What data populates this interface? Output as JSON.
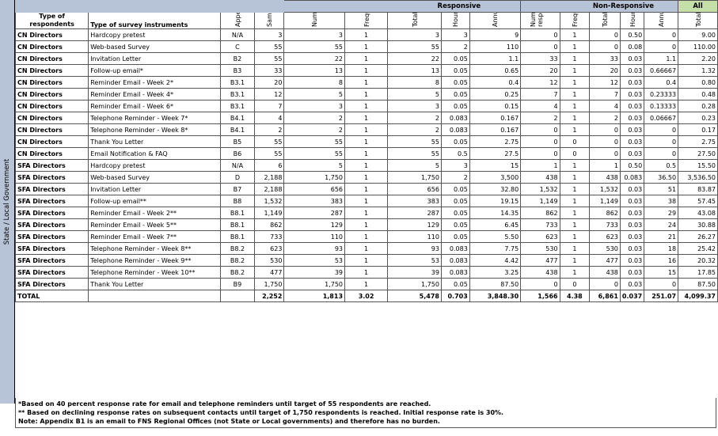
{
  "side_label": "State / Local Government",
  "groups": {
    "responsive": "Responsive",
    "non_responsive": "Non-Responsive",
    "all": "All"
  },
  "headers": [
    "Type of respondents",
    "Type of survey instruments",
    "Appendix",
    "Sample Size",
    "Number of respondents",
    "Frequency of response",
    "Total Annual responses",
    "Hours per response",
    "Annual burden (hours)",
    "Number of Non-respondents",
    "Frequency of response",
    "Total Annual responses",
    "Hours per response",
    "Annual burden (hours)",
    "Total Annual hour burden"
  ],
  "rows": [
    [
      "CN Directors",
      "Hardcopy pretest",
      "N/A",
      "3",
      "3",
      "1",
      "3",
      "3",
      "9",
      "0",
      "1",
      "0",
      "0.50",
      "0",
      "9.00"
    ],
    [
      "CN Directors",
      "Web-based Survey",
      "C",
      "55",
      "55",
      "1",
      "55",
      "2",
      "110",
      "0",
      "1",
      "0",
      "0.08",
      "0",
      "110.00"
    ],
    [
      "CN Directors",
      "Invitation Letter",
      "B2",
      "55",
      "22",
      "1",
      "22",
      "0.05",
      "1.1",
      "33",
      "1",
      "33",
      "0.03",
      "1.1",
      "2.20"
    ],
    [
      "CN Directors",
      "Follow-up email*",
      "B3",
      "33",
      "13",
      "1",
      "13",
      "0.05",
      "0.65",
      "20",
      "1",
      "20",
      "0.03",
      "0.66667",
      "1.32"
    ],
    [
      "CN Directors",
      "Reminder Email - Week 2*",
      "B3.1",
      "20",
      "8",
      "1",
      "8",
      "0.05",
      "0.4",
      "12",
      "1",
      "12",
      "0.03",
      "0.4",
      "0.80"
    ],
    [
      "CN Directors",
      "Reminder Email - Week 4*",
      "B3.1",
      "12",
      "5",
      "1",
      "5",
      "0.05",
      "0.25",
      "7",
      "1",
      "7",
      "0.03",
      "0.23333",
      "0.48"
    ],
    [
      "CN Directors",
      "Reminder Email - Week 6*",
      "B3.1",
      "7",
      "3",
      "1",
      "3",
      "0.05",
      "0.15",
      "4",
      "1",
      "4",
      "0.03",
      "0.13333",
      "0.28"
    ],
    [
      "CN Directors",
      "Telephone Reminder - Week 7*",
      "B4.1",
      "4",
      "2",
      "1",
      "2",
      "0.083",
      "0.167",
      "2",
      "1",
      "2",
      "0.03",
      "0.06667",
      "0.23"
    ],
    [
      "CN Directors",
      "Telephone Reminder - Week 8*",
      "B4.1",
      "2",
      "2",
      "1",
      "2",
      "0.083",
      "0.167",
      "0",
      "1",
      "0",
      "0.03",
      "0",
      "0.17"
    ],
    [
      "CN Directors",
      "Thank You Letter",
      "B5",
      "55",
      "55",
      "1",
      "55",
      "0.05",
      "2.75",
      "0",
      "0",
      "0",
      "0.03",
      "0",
      "2.75"
    ],
    [
      "CN Directors",
      "Email Notification & FAQ",
      "B6",
      "55",
      "55",
      "1",
      "55",
      "0.5",
      "27.5",
      "0",
      "0",
      "0",
      "0.03",
      "0",
      "27.50"
    ],
    [
      "SFA Directors",
      "Hardcopy pretest",
      "N/A",
      "6",
      "5",
      "1",
      "5",
      "3",
      "15",
      "1",
      "1",
      "1",
      "0.50",
      "0.5",
      "15.50"
    ],
    [
      "SFA Directors",
      "Web-based Survey",
      "D",
      "2,188",
      "1,750",
      "1",
      "1,750",
      "2",
      "3,500",
      "438",
      "1",
      "438",
      "0.083",
      "36.50",
      "3,536.50"
    ],
    [
      "SFA Directors",
      "Invitation Letter",
      "B7",
      "2,188",
      "656",
      "1",
      "656",
      "0.05",
      "32.80",
      "1,532",
      "1",
      "1,532",
      "0.03",
      "51",
      "83.87"
    ],
    [
      "SFA Directors",
      "Follow-up email**",
      "B8",
      "1,532",
      "383",
      "1",
      "383",
      "0.05",
      "19.15",
      "1,149",
      "1",
      "1,149",
      "0.03",
      "38",
      "57.45"
    ],
    [
      "SFA Directors",
      "Reminder Email - Week 2**",
      "B8.1",
      "1,149",
      "287",
      "1",
      "287",
      "0.05",
      "14.35",
      "862",
      "1",
      "862",
      "0.03",
      "29",
      "43.08"
    ],
    [
      "SFA Directors",
      "Reminder Email - Week 5**",
      "B8.1",
      "862",
      "129",
      "1",
      "129",
      "0.05",
      "6.45",
      "733",
      "1",
      "733",
      "0.03",
      "24",
      "30.88"
    ],
    [
      "SFA Directors",
      "Reminder Email - Week 7**",
      "B8.1",
      "733",
      "110",
      "1",
      "110",
      "0.05",
      "5.50",
      "623",
      "1",
      "623",
      "0.03",
      "21",
      "26.27"
    ],
    [
      "SFA Directors",
      "Telephone Reminder - Week 8**",
      "B8.2",
      "623",
      "93",
      "1",
      "93",
      "0.083",
      "7.75",
      "530",
      "1",
      "530",
      "0.03",
      "18",
      "25.42"
    ],
    [
      "SFA Directors",
      "Telephone Reminder - Week 9**",
      "B8.2",
      "530",
      "53",
      "1",
      "53",
      "0.083",
      "4.42",
      "477",
      "1",
      "477",
      "0.03",
      "16",
      "20.32"
    ],
    [
      "SFA Directors",
      "Telephone Reminder - Week 10**",
      "B8.2",
      "477",
      "39",
      "1",
      "39",
      "0.083",
      "3.25",
      "438",
      "1",
      "438",
      "0.03",
      "15",
      "17.85"
    ],
    [
      "SFA Directors",
      "Thank You Letter",
      "B9",
      "1,750",
      "1,750",
      "1",
      "1,750",
      "0.05",
      "87.50",
      "0",
      "0",
      "0",
      "0.03",
      "0",
      "87.50"
    ]
  ],
  "total": [
    "TOTAL",
    "",
    "",
    "2,252",
    "1,813",
    "3.02",
    "5,478",
    "0.703",
    "3,848.30",
    "1,566",
    "4.38",
    "6,861",
    "0.037",
    "251.07",
    "4,099.37"
  ],
  "notes": [
    "*Based on 40 percent response rate for email and telephone reminders until target of 55 respondents are reached.",
    "** Based on declining response rates on subsequent contacts until target of 1,750 respondents is reached. Initial response rate is 30%.",
    "Note: Appendix B1 is an email to FNS Regional Offices (not State or Local governments) and therefore has no burden."
  ]
}
